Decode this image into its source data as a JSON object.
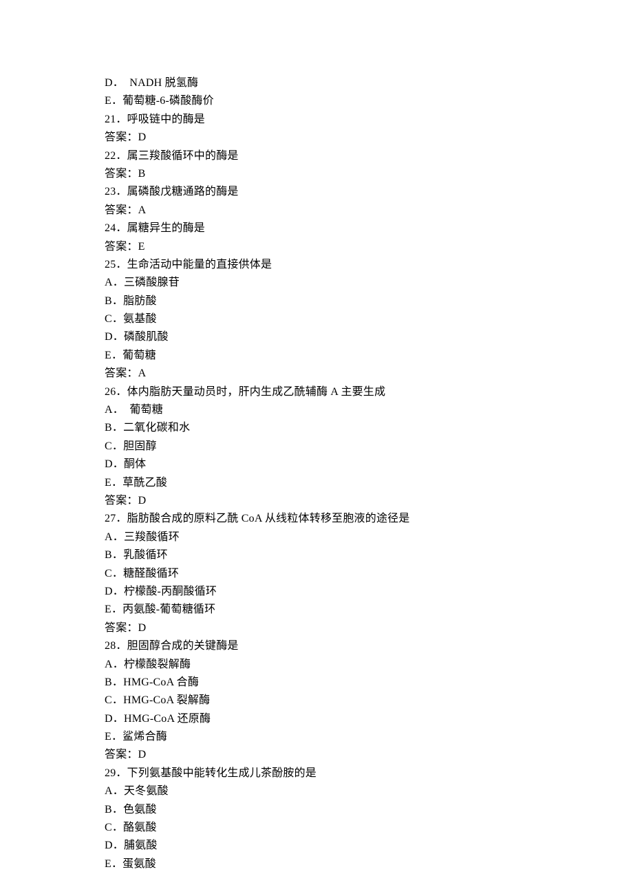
{
  "lines": [
    "D．  NADH 脱氢酶",
    "E．葡萄糖-6-磷酸酶价",
    "21．呼吸链中的酶是",
    "答案：D",
    "22．属三羧酸循环中的酶是",
    "答案：B",
    "23．属磷酸戊糖通路的酶是",
    "答案：A",
    "24．属糖异生的酶是",
    "答案：E",
    "25．生命活动中能量的直接供体是",
    "A．三磷酸腺苷",
    "B．脂肪酸",
    "C．氨基酸",
    "D．磷酸肌酸",
    "E．葡萄糖",
    "答案：A",
    "26．体内脂肪天量动员时，肝内生成乙酰辅酶 A 主要生成",
    "A．  葡萄糖",
    "B．二氧化碳和水",
    "C．胆固醇",
    "D．酮体",
    "E．草酰乙酸",
    "答案：D",
    "27．脂肪酸合成的原料乙酰 CoA 从线粒体转移至胞液的途径是",
    "A．三羧酸循环",
    "B．乳酸循环",
    "C．糖醛酸循环",
    "D．柠檬酸-丙酮酸循环",
    "E．丙氨酸-葡萄糖循环",
    "答案：D",
    "28．胆固醇合成的关键酶是",
    "A．柠檬酸裂解酶",
    "B．HMG-CoA 合酶",
    "C．HMG-CoA 裂解酶",
    "D．HMG-CoA 还原酶",
    "E．鲨烯合酶",
    "答案：D",
    "29．下列氨基酸中能转化生成儿茶酚胺的是",
    "A．天冬氨酸",
    "B．色氨酸",
    "C．酪氨酸",
    "D．脯氨酸",
    "E．蛋氨酸"
  ]
}
